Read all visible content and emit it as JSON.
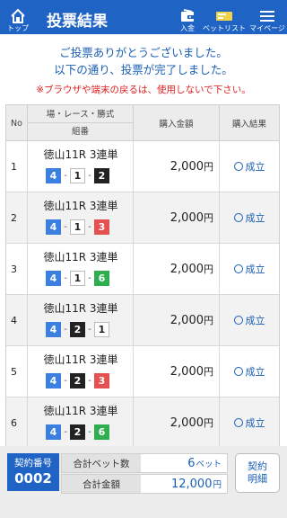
{
  "header": {
    "home_label": "トップ",
    "title": "投票結果",
    "deposit_label": "入金",
    "betlist_label": "ベットリスト",
    "mypage_label": "マイページ",
    "bg_color": "#1f63c4"
  },
  "messages": {
    "line1": "ご投票ありがとうございました。",
    "line2": "以下の通り、投票が完了しました。",
    "warning": "※ブラウザや端末の戻るは、使用しないで下さい。"
  },
  "table": {
    "headers": {
      "no": "No",
      "race_group": "場・レース・勝式",
      "combination": "組番",
      "amount": "購入金額",
      "result": "購入結果"
    },
    "rows": [
      {
        "no": "1",
        "race": "徳山11R 3連単",
        "c1": "4",
        "c2": "1",
        "c3": "2",
        "amount": "2,000",
        "yen": "円",
        "result": "成立"
      },
      {
        "no": "2",
        "race": "徳山11R 3連単",
        "c1": "4",
        "c2": "1",
        "c3": "3",
        "amount": "2,000",
        "yen": "円",
        "result": "成立"
      },
      {
        "no": "3",
        "race": "徳山11R 3連単",
        "c1": "4",
        "c2": "1",
        "c3": "6",
        "amount": "2,000",
        "yen": "円",
        "result": "成立"
      },
      {
        "no": "4",
        "race": "徳山11R 3連単",
        "c1": "4",
        "c2": "2",
        "c3": "1",
        "amount": "2,000",
        "yen": "円",
        "result": "成立"
      },
      {
        "no": "5",
        "race": "徳山11R 3連単",
        "c1": "4",
        "c2": "2",
        "c3": "3",
        "amount": "2,000",
        "yen": "円",
        "result": "成立"
      },
      {
        "no": "6",
        "race": "徳山11R 3連単",
        "c1": "4",
        "c2": "2",
        "c3": "6",
        "amount": "2,000",
        "yen": "円",
        "result": "成立"
      }
    ]
  },
  "footer": {
    "contract_label": "契約番号",
    "contract_number": "0002",
    "total_bets_label": "合計ベット数",
    "total_bets_value": "6",
    "total_bets_unit": "ベット",
    "total_amount_label": "合計金額",
    "total_amount_value": "12,000",
    "total_amount_unit": "円",
    "detail_line1": "契約",
    "detail_line2": "明細"
  },
  "boat_colors": {
    "1": "#ffffff",
    "2": "#222222",
    "3": "#e55050",
    "4": "#3b7fe0",
    "6": "#2fae4f"
  }
}
